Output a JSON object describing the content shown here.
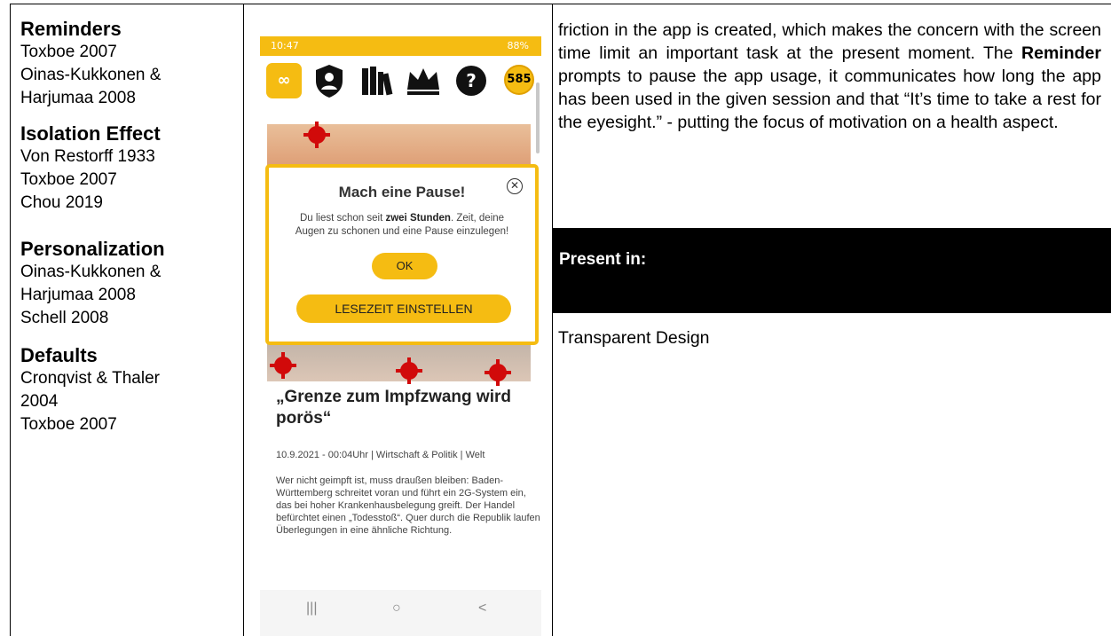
{
  "left_column": {
    "sections": [
      {
        "heading": "Reminders",
        "refs": [
          "Toxboe 2007",
          "Oinas-Kukkonen &",
          "Harjumaa 2008"
        ]
      },
      {
        "heading": "Isolation Effect",
        "refs": [
          "Von Restorff 1933",
          "Toxboe 2007",
          "Chou 2019"
        ]
      },
      {
        "heading": "Personalization",
        "refs": [
          "Oinas-Kukkonen &",
          "Harjumaa 2008",
          "Schell 2008"
        ]
      },
      {
        "heading": "Defaults",
        "refs": [
          "Cronqvist & Thaler",
          "2004",
          "Toxboe 2007"
        ]
      }
    ]
  },
  "phone": {
    "status_time": "10:47",
    "status_right": "88%",
    "coin_count": "585",
    "dialog": {
      "title": "Mach eine Pause!",
      "body_pre": "Du liest schon seit ",
      "body_bold": "zwei Stunden",
      "body_post": ". Zeit, deine Augen zu schonen und eine Pause einzulegen!",
      "ok_label": "OK",
      "settings_label": "LESEZEIT EINSTELLEN"
    },
    "article": {
      "headline": "„Grenze zum Impfzwang wird porös“",
      "meta": "10.9.2021 - 00:04Uhr | Wirtschaft & Politik | Welt",
      "teaser": "Wer nicht geimpft ist, muss draußen bleiben: Baden-Württemberg schreitet voran und führt ein 2G-System ein, das bei hoher Krankenhausbelegung greift. Der Handel befürchtet einen „Todesstoß“. Quer durch die Republik laufen Überlegungen in eine ähnliche Richtung."
    },
    "nav": {
      "recent": "|||",
      "home": "○",
      "back": "<"
    }
  },
  "right_column": {
    "para_pre": "friction in the app is created, which makes the concern with the screen time limit an important task at the present moment. The ",
    "para_bold": "Reminder",
    "para_post": " prompts to pause the app usage, it communicates how long the app has been used in the given session and that “It’s time to take a rest for the eyesight.” - putting the focus of motivation on a health aspect.",
    "present_label": "Present in:",
    "present_item": "Transparent Design"
  },
  "colors": {
    "accent": "#f5bc12",
    "virus": "#d10a0a"
  },
  "icons": [
    "logo-icon",
    "shield-user-icon",
    "books-icon",
    "crown-icon",
    "help-icon",
    "coin-icon"
  ]
}
